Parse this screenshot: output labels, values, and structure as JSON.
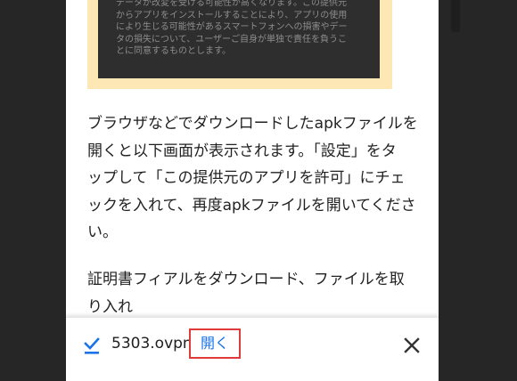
{
  "embedded_notice": {
    "lines": [
      "データが改変を受ける可能性が高くなります。この提供元",
      "からアプリをインストールすることにより、アプリの使用",
      "により生じる可能性があるスマートフォンへの損害やデー",
      "タの損失について、ユーザーご自身が単独で責任を負うこ",
      "とに同意するものとします。"
    ]
  },
  "article": {
    "paragraph1_lines": [
      "ブラウザなどでダウンロードしたapkファイルを",
      "開くと以下画面が表示されます。「設定」をタ",
      "ップして「この提供元のアプリを許可」にチェ",
      "ックを入れて、再度apkファイルを開いてくださ",
      "い。"
    ],
    "paragraph2_lines": [
      "証明書フィアルをダウンロード、ファイルを取",
      "り入れ"
    ]
  },
  "download_bar": {
    "file_name": "5303.ovpn。",
    "open_label": "開く",
    "check_icon": "download-check-icon",
    "close_icon": "close-icon",
    "accent_color": "#1a73e8",
    "highlight_color": "#e03a3a"
  }
}
